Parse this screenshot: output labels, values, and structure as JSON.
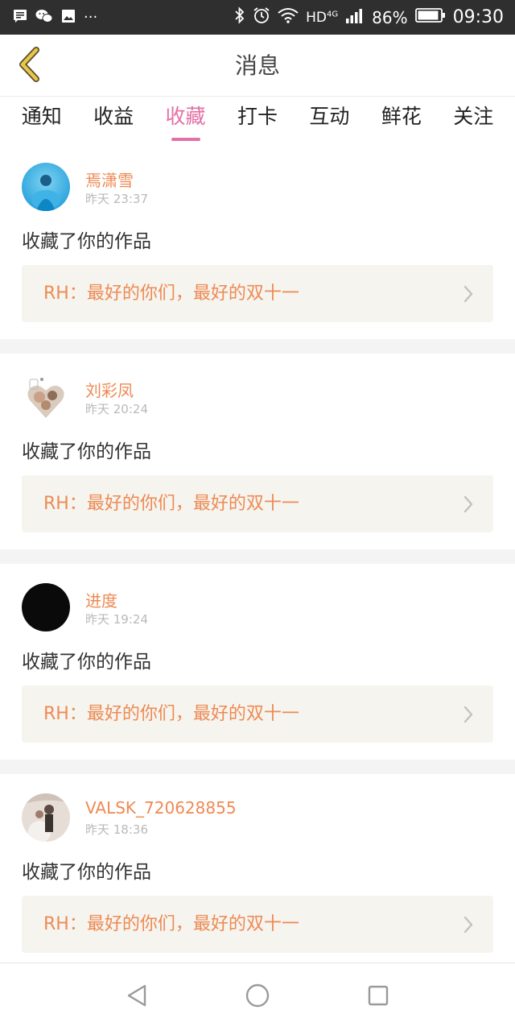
{
  "status_bar": {
    "icons": [
      "message-icon",
      "wechat-icon",
      "image-icon",
      "more-icon",
      "bluetooth-icon",
      "alarm-icon",
      "wifi-icon",
      "signal-icon",
      "battery-icon"
    ],
    "more_glyph": "···",
    "network": "HD",
    "network_sub": "4G",
    "battery_percent": "86%",
    "time": "09:30"
  },
  "header": {
    "title": "消息",
    "back_icon": "chevron-left-icon"
  },
  "tabs": [
    {
      "label": "通知",
      "active": false
    },
    {
      "label": "收益",
      "active": false
    },
    {
      "label": "收藏",
      "active": true
    },
    {
      "label": "打卡",
      "active": false
    },
    {
      "label": "互动",
      "active": false
    },
    {
      "label": "鲜花",
      "active": false
    },
    {
      "label": "关注",
      "active": false
    }
  ],
  "messages": [
    {
      "user": "焉潇雪",
      "time": "昨天 23:37",
      "action": "收藏了你的作品",
      "work_title": "RH：最好的你们，最好的双十一"
    },
    {
      "user": "刘彩凤",
      "time": "昨天 20:24",
      "action": "收藏了你的作品",
      "work_title": "RH：最好的你们，最好的双十一"
    },
    {
      "user": "进度",
      "time": "昨天 19:24",
      "action": "收藏了你的作品",
      "work_title": "RH：最好的你们，最好的双十一"
    },
    {
      "user": "VALSK_720628855",
      "time": "昨天 18:36",
      "action": "收藏了你的作品",
      "work_title": "RH：最好的你们，最好的双十一"
    }
  ],
  "colors": {
    "accent_pink": "#e371a5",
    "accent_orange": "#ee8a54",
    "card_bg": "#f5f4ee",
    "status_bar": "#2f2f2f",
    "back_icon": "#e8c64a"
  },
  "nav": {
    "icons": [
      "back-triangle-icon",
      "home-circle-icon",
      "recents-square-icon"
    ]
  }
}
